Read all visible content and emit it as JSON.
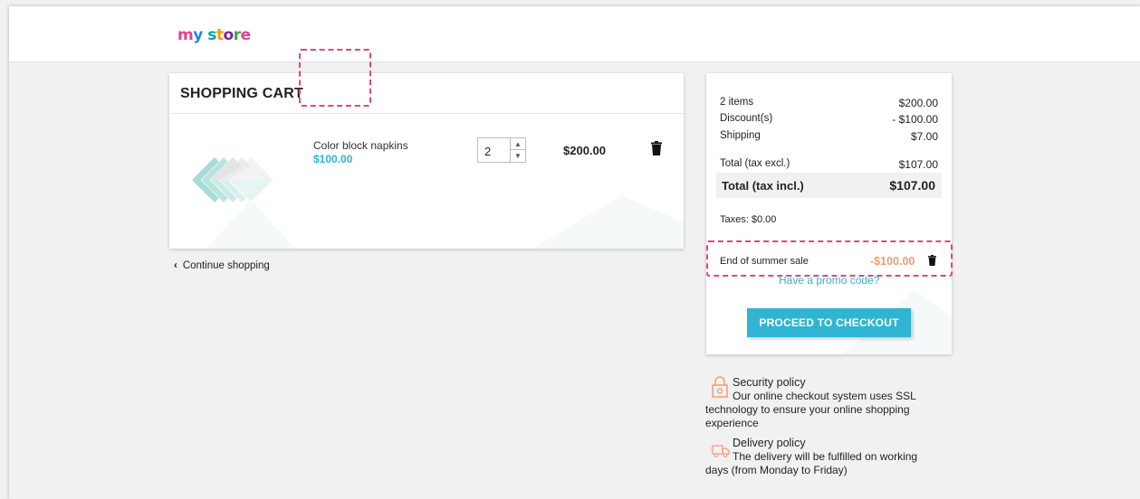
{
  "header": {
    "logo": "my store"
  },
  "cart": {
    "title": "SHOPPING CART",
    "item": {
      "name": "Color block napkins",
      "unit_price": "$100.00",
      "quantity": "2",
      "line_total": "$200.00"
    },
    "continue_label": "Continue shopping"
  },
  "summary": {
    "items_label": "2 items",
    "items_value": "$200.00",
    "discount_label": "Discount(s)",
    "discount_value": "- $100.00",
    "shipping_label": "Shipping",
    "shipping_value": "$7.00",
    "total_excl_label": "Total (tax excl.)",
    "total_excl_value": "$107.00",
    "total_incl_label": "Total (tax incl.)",
    "total_incl_value": "$107.00",
    "taxes": "Taxes: $0.00",
    "voucher_name": "End of summer sale",
    "voucher_amount": "-$100.00",
    "promo_link": "Have a promo code?",
    "checkout_label": "PROCEED TO CHECKOUT"
  },
  "reassurance": [
    {
      "title": "Security policy",
      "text": "Our online checkout system uses SSL technology to ensure your online shopping experience",
      "icon": "lock-icon"
    },
    {
      "title": "Delivery policy",
      "text": "The delivery will be fulfilled on working days (from Monday to Friday)",
      "icon": "truck-icon"
    }
  ],
  "colors": {
    "accent": "#2fb5d2",
    "highlight": "#e8437b",
    "voucher": "#f39d72"
  }
}
